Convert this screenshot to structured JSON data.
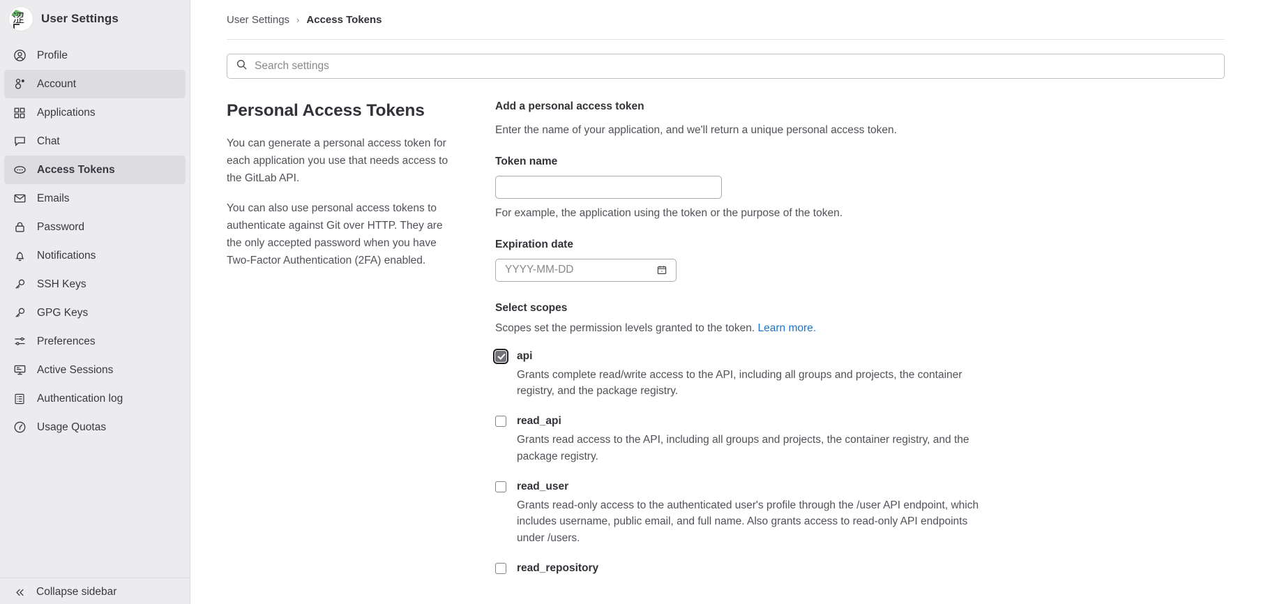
{
  "sidebar": {
    "title": "User Settings",
    "avatar_name": "user-avatar",
    "items": [
      {
        "label": "Profile",
        "icon": "user-circle-icon",
        "state": "normal"
      },
      {
        "label": "Account",
        "icon": "account-person-icon",
        "state": "shaded"
      },
      {
        "label": "Applications",
        "icon": "grid-squares-icon",
        "state": "normal"
      },
      {
        "label": "Chat",
        "icon": "chat-bubble-icon",
        "state": "normal"
      },
      {
        "label": "Access Tokens",
        "icon": "token-oval-icon",
        "state": "active"
      },
      {
        "label": "Emails",
        "icon": "envelope-icon",
        "state": "normal"
      },
      {
        "label": "Password",
        "icon": "lock-icon",
        "state": "normal"
      },
      {
        "label": "Notifications",
        "icon": "bell-icon",
        "state": "normal"
      },
      {
        "label": "SSH Keys",
        "icon": "key-icon",
        "state": "normal"
      },
      {
        "label": "GPG Keys",
        "icon": "key-icon",
        "state": "normal"
      },
      {
        "label": "Preferences",
        "icon": "sliders-icon",
        "state": "normal"
      },
      {
        "label": "Active Sessions",
        "icon": "monitor-icon",
        "state": "normal"
      },
      {
        "label": "Authentication log",
        "icon": "list-document-icon",
        "state": "normal"
      },
      {
        "label": "Usage Quotas",
        "icon": "quota-gauge-icon",
        "state": "normal"
      }
    ],
    "collapse_label": "Collapse sidebar"
  },
  "breadcrumb": {
    "parent": "User Settings",
    "separator": "›",
    "current": "Access Tokens"
  },
  "search": {
    "placeholder": "Search settings",
    "value": ""
  },
  "left_column": {
    "heading": "Personal Access Tokens",
    "paragraphs": [
      "You can generate a personal access token for each application you use that needs access to the GitLab API.",
      "You can also use personal access tokens to authenticate against Git over HTTP. They are the only accepted password when you have Two-Factor Authentication (2FA) enabled."
    ]
  },
  "form": {
    "heading": "Add a personal access token",
    "lead": "Enter the name of your application, and we'll return a unique personal access token.",
    "token_name": {
      "label": "Token name",
      "value": "",
      "placeholder": "",
      "helper": "For example, the application using the token or the purpose of the token."
    },
    "expiration_date": {
      "label": "Expiration date",
      "value": "",
      "placeholder": "YYYY-MM-DD",
      "calendar_icon": "calendar-icon"
    },
    "scopes": {
      "label": "Select scopes",
      "description": "Scopes set the permission levels granted to the token.",
      "learn_more": "Learn more.",
      "items": [
        {
          "name": "api",
          "checked": true,
          "focused": true,
          "description": "Grants complete read/write access to the API, including all groups and projects, the container registry, and the package registry."
        },
        {
          "name": "read_api",
          "checked": false,
          "focused": false,
          "description": "Grants read access to the API, including all groups and projects, the container registry, and the package registry."
        },
        {
          "name": "read_user",
          "checked": false,
          "focused": false,
          "description": "Grants read-only access to the authenticated user's profile through the /user API endpoint, which includes username, public email, and full name. Also grants access to read-only API endpoints under /users."
        },
        {
          "name": "read_repository",
          "checked": false,
          "focused": false,
          "description": ""
        }
      ]
    }
  },
  "colors": {
    "sidebar_bg": "#ececef",
    "active_item_bg": "#dcdce1",
    "link_blue": "#1f75cb",
    "text_primary": "#333238",
    "text_muted": "#535158",
    "checkbox_checked": "#737278"
  }
}
